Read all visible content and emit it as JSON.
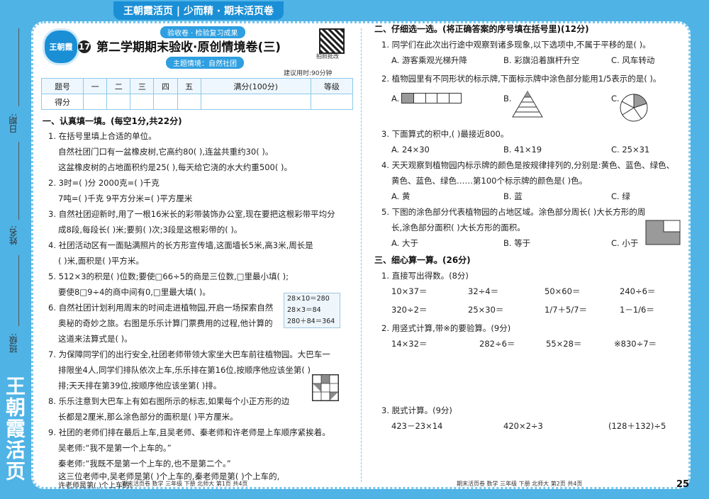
{
  "header": {
    "banner": "王朝霞活页 | 少而精 · 期末活页卷",
    "tag_top": "验收卷 · 检验复习成果",
    "tag_theme": "主题情境：自然社团",
    "logo_text": "王朝霞",
    "number": "17",
    "title": "第二学期期末验收·原创情境卷(三)",
    "qr_caption": "拍照批改",
    "time_note": "建议用时:90分钟"
  },
  "side": {
    "date_label": "日期:",
    "name_label": "姓名:",
    "class_label": "班级:",
    "brand": "王朝霞活页"
  },
  "score_table": {
    "row1": [
      "题号",
      "一",
      "二",
      "三",
      "四",
      "五",
      "满分(100分)",
      "等级"
    ],
    "row2": [
      "得分",
      "",
      "",
      "",
      "",
      "",
      "",
      ""
    ]
  },
  "part1": {
    "heading": "一、认真填一填。(每空1分,共22分)",
    "lines": [
      "1. 在括号里填上合适的单位。",
      "自然社团门口有一盆橡皮树,它高约80(        ),连盆共重约30(        )。",
      "这盆橡皮树的占地面积约是25(        ),每天给它浇的水大约重500(        )。",
      "2. 3时=(          )分              2000克=(          )千克",
      "7吨=(          )千克              9平方分米=(          )平方厘米",
      "3. 自然社团迎新时,用了一根16米长的彩带装饰办公室,现在要把这根彩带平均分",
      "成8段,每段长(          )米;要剪(          )次;3段是这根彩带的(          )。",
      "4. 社团活动区有一面贴满照片的长方形宣传墙,这面墙长5米,高3米,周长是",
      "(          )米,面积是(          )平方米。",
      "5. 512×3的积是(          )位数;要使□66÷5的商是三位数,□里最小填(          );",
      "要使8□9÷4的商中间有0,□里最大填(          )。",
      "6. 自然社团计划利用周末的时间走进植物园,开启一场探索自然",
      "奥秘的奇妙之旅。右图是乐乐计算门票费用的过程,他计算的",
      "这道来法算式是(                              )。",
      "7. 为保障同学们的出行安全,社团老师带领大家坐大巴车前往植物园。大巴车一",
      "排限坐4人,同学们排队依次上车,乐乐排在第16位,按顺序他应该坐第(          )",
      "排;天天排在第39位,按顺序他应该坐第(          )排。",
      "8. 乐乐注意到大巴车上有如右图所示的标志,如果每个小正方形的边",
      "长都是2厘米,那么涂色部分的面积是(          )平方厘米。",
      "9. 社团的老师们排在最后上车,且吴老师、秦老师和许老师是上车顺序紧挨着。",
      "吴老师:“我不是第一个上车的。”",
      "秦老师:“我既不是第一个上车的,也不是第二个。”",
      "这三位老师中,吴老师是第(          )个上车的,秦老师是第(          )个上车的,",
      "许老师是第(          )个上车的。"
    ],
    "calc_box": [
      "28×10＝280",
      "28×3＝84",
      "280＋84＝364"
    ]
  },
  "part2": {
    "heading": "二、仔细选一选。(将正确答案的序号填在括号里)(12分)",
    "q1": "1. 同学们在此次出行途中观察到诸多现象,以下选项中,不属于平移的是(        )。",
    "q1_opts": [
      "A. 游客乘观光梯升降",
      "B. 彩旗沿着旗杆升空",
      "C. 风车转动"
    ],
    "q2": "2. 植物园里有不同形状的标示牌,下面标示牌中涂色部分能用1/5表示的是(        )。",
    "q2_opts": [
      "A.",
      "B.",
      "C."
    ],
    "q3": "3. 下面算式的积中,(        )最接近800。",
    "q3_opts": [
      "A. 24×30",
      "B. 41×19",
      "C. 25×31"
    ],
    "q4a": "4. 天天观察到植物园内标示牌的颜色是按规律排列的,分别是:黄色、蓝色、绿色、",
    "q4b": "黄色、蓝色、绿色……第100个标示牌的颜色是(        )色。",
    "q4_opts": [
      "A. 黄",
      "B. 蓝",
      "C. 绿"
    ],
    "q5a": "5. 下图的涂色部分代表植物园的占地区域。涂色部分周长(        )大长方形的周",
    "q5b": "长,涂色部分面积(        )大长方形的面积。",
    "q5_opts": [
      "A. 大于",
      "B. 等于",
      "C. 小于"
    ]
  },
  "part3": {
    "heading": "三、细心算一算。(26分)",
    "s1": "1. 直接写出得数。(8分)",
    "row1": [
      "10×37＝",
      "32÷4＝",
      "50×60＝",
      "240÷6＝"
    ],
    "row2": [
      "320÷2＝",
      "25×30＝",
      "1/7＋5/7＝",
      "1－1/6＝"
    ],
    "s2": "2. 用竖式计算,带※的要验算。(9分)",
    "row3": [
      "14×32＝",
      "282÷6＝",
      "55×28＝",
      "※830÷7＝"
    ],
    "s3": "3. 脱式计算。(9分)",
    "row4": [
      "423－23×14",
      "420×2÷3",
      "(128＋132)÷5"
    ]
  },
  "footer": {
    "left": "期末活页卷  数学  三年级  下册  北师大  第1页  共4页",
    "right": "期末活页卷  数学  三年级  下册  北师大  第2页  共4页",
    "page_number": "25"
  }
}
